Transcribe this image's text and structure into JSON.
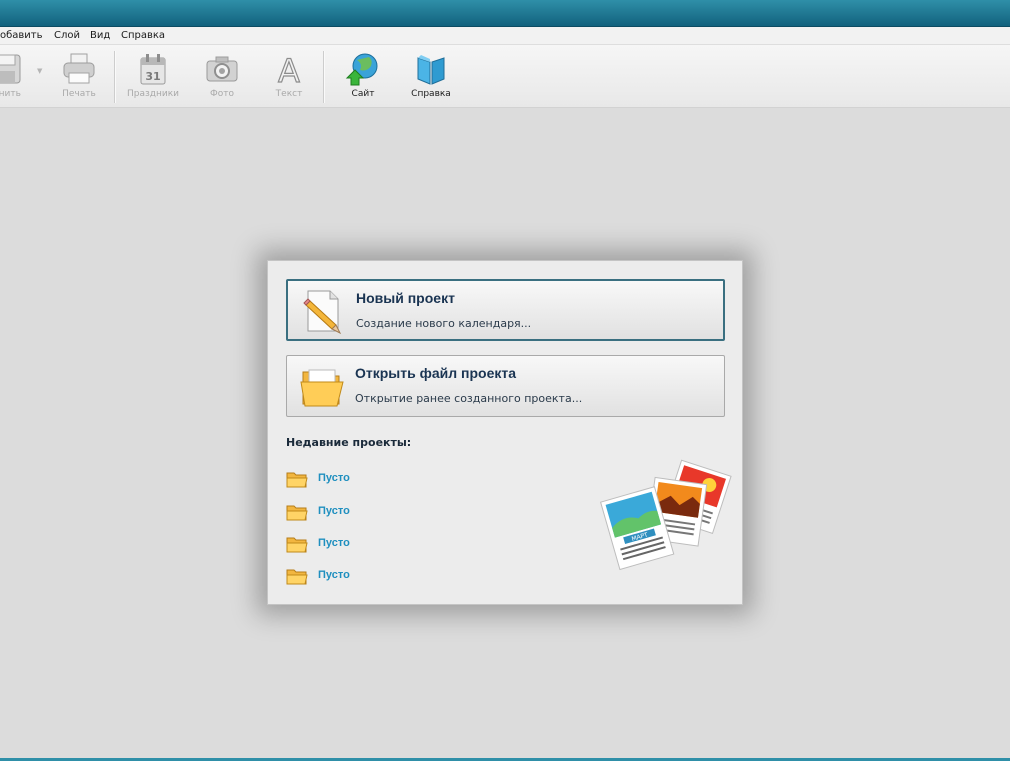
{
  "menu": {
    "items": [
      "обавить",
      "Слой",
      "Вид",
      "Справка"
    ]
  },
  "toolbar": {
    "save_label": "анить",
    "print_label": "Печать",
    "holidays_label": "Праздники",
    "photo_label": "Фото",
    "text_label": "Текст",
    "site_label": "Сайт",
    "help_label": "Справка",
    "calendar_day": "31",
    "text_glyph": "A"
  },
  "dialog": {
    "new_project": {
      "title": "Новый проект",
      "subtitle": "Создание нового календаря..."
    },
    "open_project": {
      "title": "Открыть файл проекта",
      "subtitle": "Открытие ранее созданного проекта..."
    },
    "recent_title": "Недавние проекты:",
    "recent_items": [
      "Пусто",
      "Пусто",
      "Пусто",
      "Пусто"
    ],
    "illustration_month": "МАРТ"
  },
  "colors": {
    "titlebar": "#1a6f8b",
    "link": "#1f8fbf",
    "heading": "#1a3452"
  },
  "icons": [
    "save-icon",
    "print-icon",
    "calendar-icon",
    "camera-icon",
    "text-icon",
    "globe-icon",
    "book-icon",
    "pencil-document-icon",
    "open-folder-icon",
    "folder-icon"
  ]
}
